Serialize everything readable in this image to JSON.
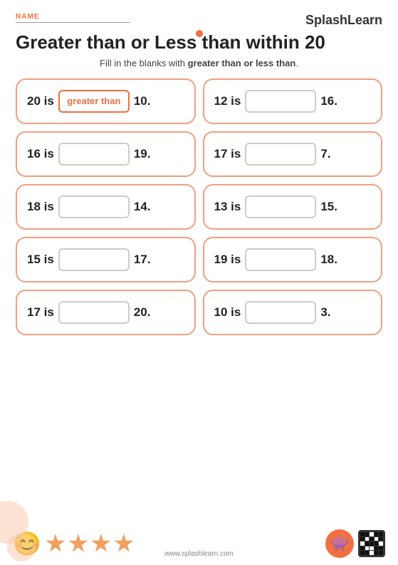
{
  "header": {
    "name_label": "NAME",
    "logo_splash": "Splash",
    "logo_learn": "Learn"
  },
  "title": "Greater than or Less than within 20",
  "subtitle": {
    "prefix": "Fill in the blanks with ",
    "highlight": "greater than or less than",
    "suffix": "."
  },
  "problems": [
    {
      "id": 1,
      "left": "20",
      "answer": "greater than",
      "right": "10.",
      "filled": true
    },
    {
      "id": 2,
      "left": "12",
      "answer": "",
      "right": "16.",
      "filled": false
    },
    {
      "id": 3,
      "left": "16",
      "answer": "",
      "right": "19.",
      "filled": false
    },
    {
      "id": 4,
      "left": "17",
      "answer": "",
      "right": "7.",
      "filled": false
    },
    {
      "id": 5,
      "left": "18",
      "answer": "",
      "right": "14.",
      "filled": false
    },
    {
      "id": 6,
      "left": "13",
      "answer": "",
      "right": "15.",
      "filled": false
    },
    {
      "id": 7,
      "left": "15",
      "answer": "",
      "right": "17.",
      "filled": false
    },
    {
      "id": 8,
      "left": "19",
      "answer": "",
      "right": "18.",
      "filled": false
    },
    {
      "id": 9,
      "left": "17",
      "answer": "",
      "right": "20.",
      "filled": false
    },
    {
      "id": 10,
      "left": "10",
      "answer": "",
      "right": "3.",
      "filled": false
    }
  ],
  "footer": {
    "website": "www.splashlearn.com"
  }
}
